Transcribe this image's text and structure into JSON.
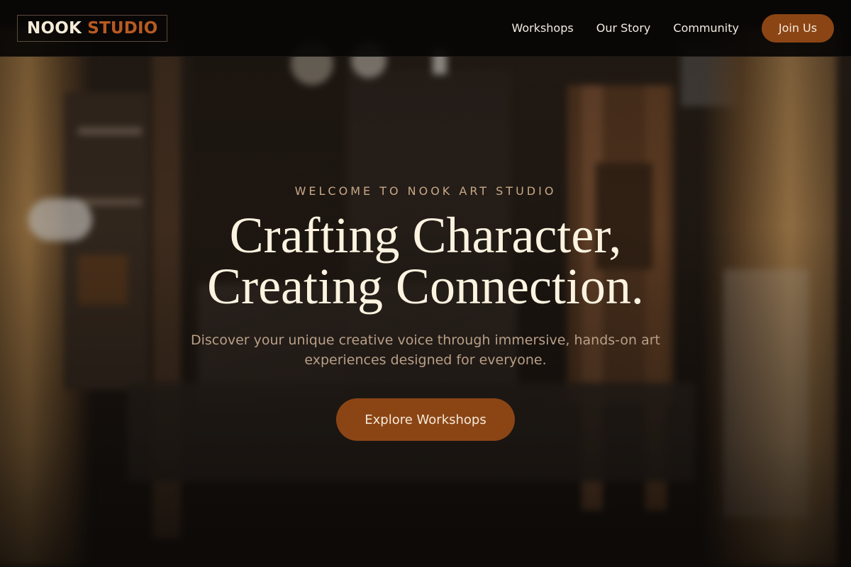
{
  "brand": {
    "logo_part1": "NOOK",
    "logo_part2": "STUDIO",
    "primary_color": "#8b4515",
    "accent_color": "#b85a22"
  },
  "nav": {
    "links": [
      {
        "label": "Workshops"
      },
      {
        "label": "Our Story"
      },
      {
        "label": "Community"
      }
    ],
    "join_label": "Join Us"
  },
  "hero": {
    "eyebrow": "WELCOME TO NOOK ART STUDIO",
    "headline_line1": "Crafting Character,",
    "headline_line2": "Creating Connection.",
    "subtitle": "Discover your unique creative voice through immersive, hands-on art experiences designed for everyone.",
    "cta_label": "Explore Workshops"
  }
}
